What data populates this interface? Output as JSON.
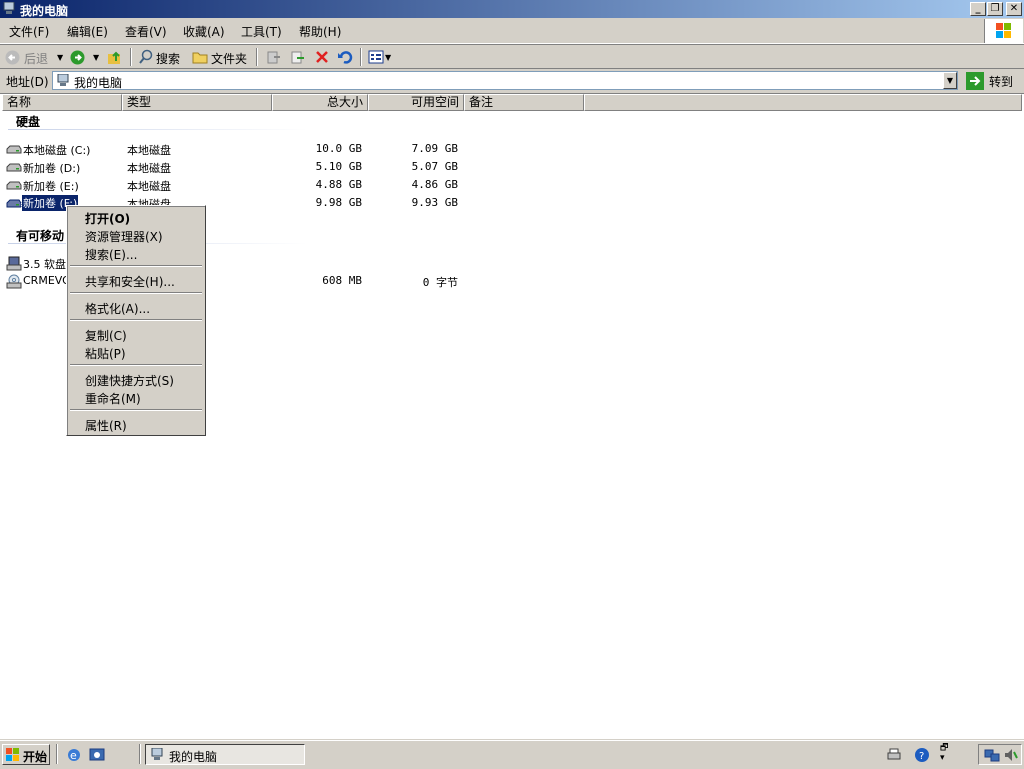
{
  "window": {
    "title": "我的电脑"
  },
  "menu": [
    "文件(F)",
    "编辑(E)",
    "查看(V)",
    "收藏(A)",
    "工具(T)",
    "帮助(H)"
  ],
  "toolbar": {
    "back": "后退",
    "search": "搜索",
    "folders": "文件夹"
  },
  "address": {
    "label": "地址(D)",
    "value": "我的电脑",
    "go": "转到"
  },
  "columns": [
    "名称",
    "类型",
    "总大小",
    "可用空间",
    "备注"
  ],
  "groups": {
    "hard_disks": "硬盘",
    "removable": "有可移动"
  },
  "drives": [
    {
      "name": "本地磁盘 (C:)",
      "type": "本地磁盘",
      "total": "10.0 GB",
      "free": "7.09 GB"
    },
    {
      "name": "新加卷 (D:)",
      "type": "本地磁盘",
      "total": "5.10 GB",
      "free": "5.07 GB"
    },
    {
      "name": "新加卷 (E:)",
      "type": "本地磁盘",
      "total": "4.88 GB",
      "free": "4.86 GB"
    },
    {
      "name": "新加卷 (F:)",
      "type": "本地磁盘",
      "total": "9.98 GB",
      "free": "9.93 GB"
    }
  ],
  "removable": [
    {
      "name": "3.5 软盘",
      "type": "",
      "total": "",
      "free": ""
    },
    {
      "name": "CRMEVOL",
      "type": "",
      "total": "608 MB",
      "free": "0 字节"
    }
  ],
  "context_menu": [
    "打开(O)",
    "资源管理器(X)",
    "搜索(E)...",
    "共享和安全(H)...",
    "格式化(A)...",
    "复制(C)",
    "粘贴(P)",
    "创建快捷方式(S)",
    "重命名(M)",
    "属性(R)"
  ],
  "taskbar": {
    "start": "开始",
    "task": "我的电脑"
  },
  "colors": {
    "title_start": "#0a246a",
    "title_end": "#a6caf0",
    "selection": "#0a246a",
    "face": "#d4d0c8"
  }
}
